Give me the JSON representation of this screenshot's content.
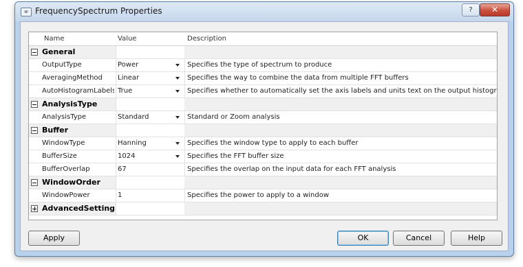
{
  "window": {
    "title": "FrequencySpectrum Properties",
    "app_icon": "app-window-icon",
    "help_glyph": "?",
    "close_glyph": "✕"
  },
  "grid": {
    "columns": {
      "name": "Name",
      "value": "Value",
      "description": "Description"
    },
    "rows": [
      {
        "type": "category",
        "label": "General",
        "expanded": true
      },
      {
        "type": "property",
        "name": "OutputType",
        "value": "Power",
        "description": "Specifies the type of spectrum to produce",
        "dropdown": true
      },
      {
        "type": "property",
        "name": "AveragingMethod",
        "value": "Linear",
        "description": "Specifies the way to combine the data from multiple FFT buffers",
        "dropdown": true
      },
      {
        "type": "property",
        "name": "AutoHistogramLabels",
        "value": "True",
        "description": "Specifies whether to automatically set the axis labels and units text on the output histogram",
        "dropdown": true
      },
      {
        "type": "category",
        "label": "AnalysisType",
        "expanded": true
      },
      {
        "type": "property",
        "name": "AnalysisType",
        "value": "Standard",
        "description": "Standard or Zoom analysis",
        "dropdown": true
      },
      {
        "type": "category",
        "label": "Buffer",
        "expanded": true
      },
      {
        "type": "property",
        "name": "WindowType",
        "value": "Hanning",
        "description": "Specifies the window type to apply to each buffer",
        "dropdown": true
      },
      {
        "type": "property",
        "name": "BufferSize",
        "value": "1024",
        "description": "Specifies the FFT buffer size",
        "dropdown": true
      },
      {
        "type": "property",
        "name": "BufferOverlap",
        "value": "67",
        "description": "Specifies the overlap on the input data for each FFT analysis",
        "dropdown": false
      },
      {
        "type": "category",
        "label": "WindowOrder",
        "expanded": true
      },
      {
        "type": "property",
        "name": "WindowPower",
        "value": "1",
        "description": "Specifies the power to apply to a window",
        "dropdown": false
      },
      {
        "type": "category",
        "label": "AdvancedSettings",
        "expanded": false
      }
    ]
  },
  "buttons": {
    "apply": "Apply",
    "ok": "OK",
    "cancel": "Cancel",
    "help": "Help"
  },
  "colors": {
    "title_bar": "#c4d7ec",
    "category_band": "#f0f0f0",
    "close_button": "#c9503d",
    "default_button_border": "#3c7fb1"
  }
}
